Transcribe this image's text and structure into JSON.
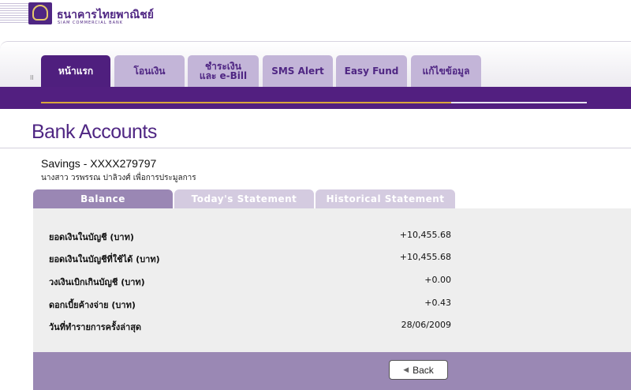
{
  "header": {
    "bank_name_th": "ธนาคารไทยพาณิชย์",
    "bank_name_en": "SIAM COMMERCIAL BANK"
  },
  "nav": {
    "marker": "II",
    "tabs": [
      {
        "label": "หน้าแรก",
        "active": true
      },
      {
        "label": "โอนเงิน",
        "active": false
      },
      {
        "label_line1": "ชำระเงิน",
        "label_line2": "และ e-Bill",
        "active": false
      },
      {
        "label": "SMS Alert",
        "active": false
      },
      {
        "label": "Easy Fund",
        "active": false
      },
      {
        "label": "แก้ไขข้อมูล",
        "active": false
      }
    ]
  },
  "page": {
    "title": "Bank Accounts",
    "account_name": "Savings - XXXX279797",
    "account_owner": "นางสาว วรพรรณ ปาลิวงศ์ เพื่อการประมูลการ"
  },
  "subtabs": [
    {
      "label": "Balance",
      "active": true
    },
    {
      "label": "Today's Statement",
      "active": false
    },
    {
      "label": "Historical Statement",
      "active": false
    }
  ],
  "balance_rows": [
    {
      "label": "ยอดเงินในบัญชี (บาท)",
      "value": "+10,455.68"
    },
    {
      "label": "ยอดเงินในบัญชีที่ใช้ได้ (บาท)",
      "value": "+10,455.68"
    },
    {
      "label": "วงเงินเบิกเกินบัญชี (บาท)",
      "value": "+0.00"
    },
    {
      "label": "ดอกเบี้ยค้างจ่าย (บาท)",
      "value": "+0.43"
    },
    {
      "label": "วันที่ทำรายการครั้งล่าสุด",
      "value": "28/06/2009"
    }
  ],
  "actions": {
    "back_label": "Back"
  },
  "colors": {
    "brand_purple": "#4f2683",
    "gold": "#d9a63c"
  }
}
